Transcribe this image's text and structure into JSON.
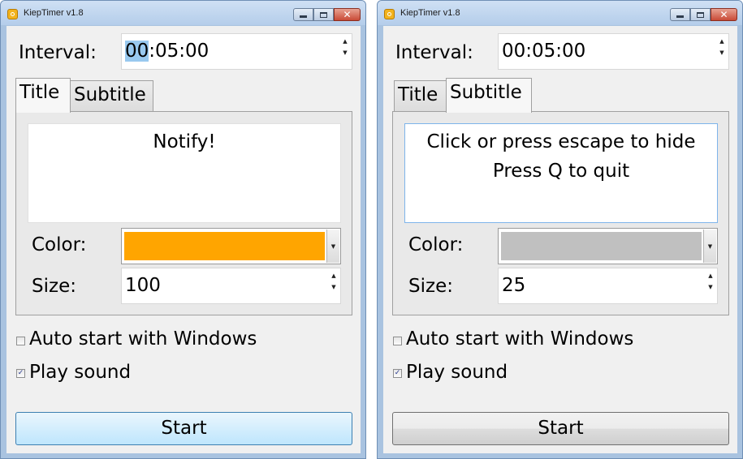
{
  "windows": [
    {
      "title": "KiepTimer v1.8",
      "controls": {
        "minimize": "minimize",
        "maximize": "maximize",
        "close": "close"
      },
      "interval": {
        "label": "Interval:",
        "value_selected": "00",
        "value_rest": ":05:00"
      },
      "tabs": [
        {
          "label": "Title",
          "active": true
        },
        {
          "label": "Subtitle",
          "active": false
        }
      ],
      "text_lines": [
        "Notify!",
        ""
      ],
      "color": {
        "label": "Color:",
        "value": "#ffa500"
      },
      "size": {
        "label": "Size:",
        "value": "100"
      },
      "auto_start": {
        "label": "Auto start with Windows",
        "checked": false
      },
      "play_sound": {
        "label": "Play sound",
        "checked": true
      },
      "start_label": "Start"
    },
    {
      "title": "KiepTimer v1.8",
      "controls": {
        "minimize": "minimize",
        "maximize": "maximize",
        "close": "close"
      },
      "interval": {
        "label": "Interval:",
        "value_selected": "",
        "value_rest": "00:05:00"
      },
      "tabs": [
        {
          "label": "Title",
          "active": false
        },
        {
          "label": "Subtitle",
          "active": true
        }
      ],
      "text_lines": [
        "Click or press escape to hide",
        "Press Q to quit"
      ],
      "color": {
        "label": "Color:",
        "value": "#c0c0c0"
      },
      "size": {
        "label": "Size:",
        "value": "25"
      },
      "auto_start": {
        "label": "Auto start with Windows",
        "checked": false
      },
      "play_sound": {
        "label": "Play sound",
        "checked": true
      },
      "start_label": "Start"
    }
  ],
  "icons": {
    "app": "timer-app-icon",
    "check": "✓",
    "spin_up": "▲",
    "spin_down": "▼",
    "combo": "▼",
    "close_glyph": "✕"
  }
}
